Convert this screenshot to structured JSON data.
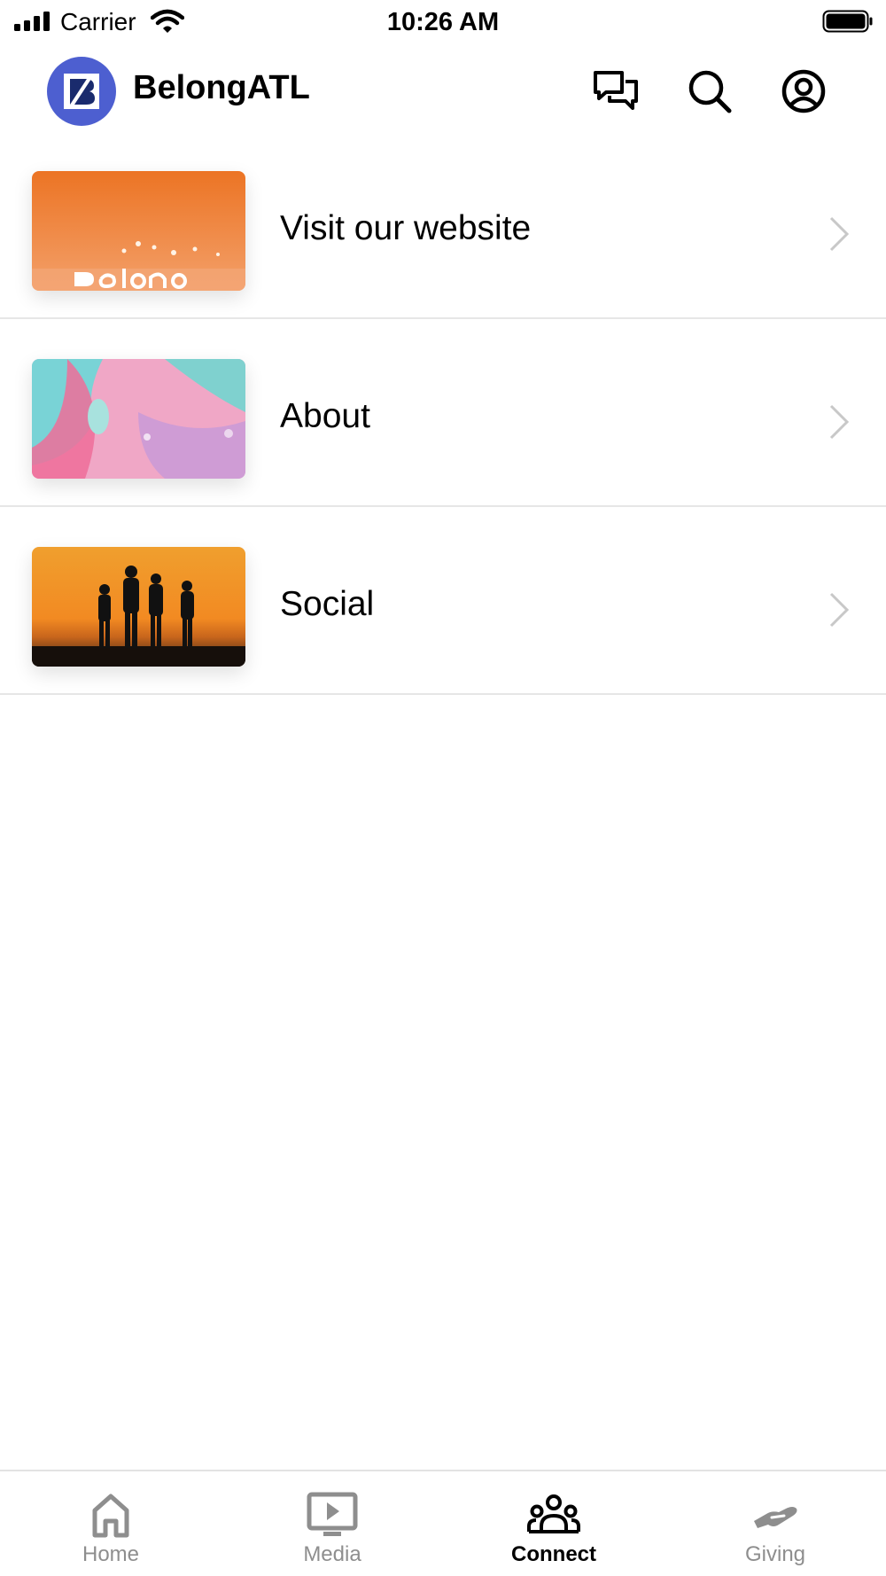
{
  "status_bar": {
    "carrier": "Carrier",
    "time": "10:26 AM"
  },
  "header": {
    "title": "BelongATL",
    "icons": [
      "chat-icon",
      "search-icon",
      "profile-icon"
    ],
    "logo_color": "#4d5fd0"
  },
  "list": {
    "items": [
      {
        "label": "Visit our website",
        "thumbnail": "orange-concert-stage"
      },
      {
        "label": "About",
        "thumbnail": "pink-teal-fluid-art"
      },
      {
        "label": "Social",
        "thumbnail": "sunset-silhouettes"
      }
    ]
  },
  "tabbar": {
    "active": "Connect",
    "tabs": [
      {
        "label": "Home",
        "icon": "home-icon"
      },
      {
        "label": "Media",
        "icon": "media-icon"
      },
      {
        "label": "Connect",
        "icon": "people-icon"
      },
      {
        "label": "Giving",
        "icon": "giving-hand-icon"
      }
    ]
  }
}
